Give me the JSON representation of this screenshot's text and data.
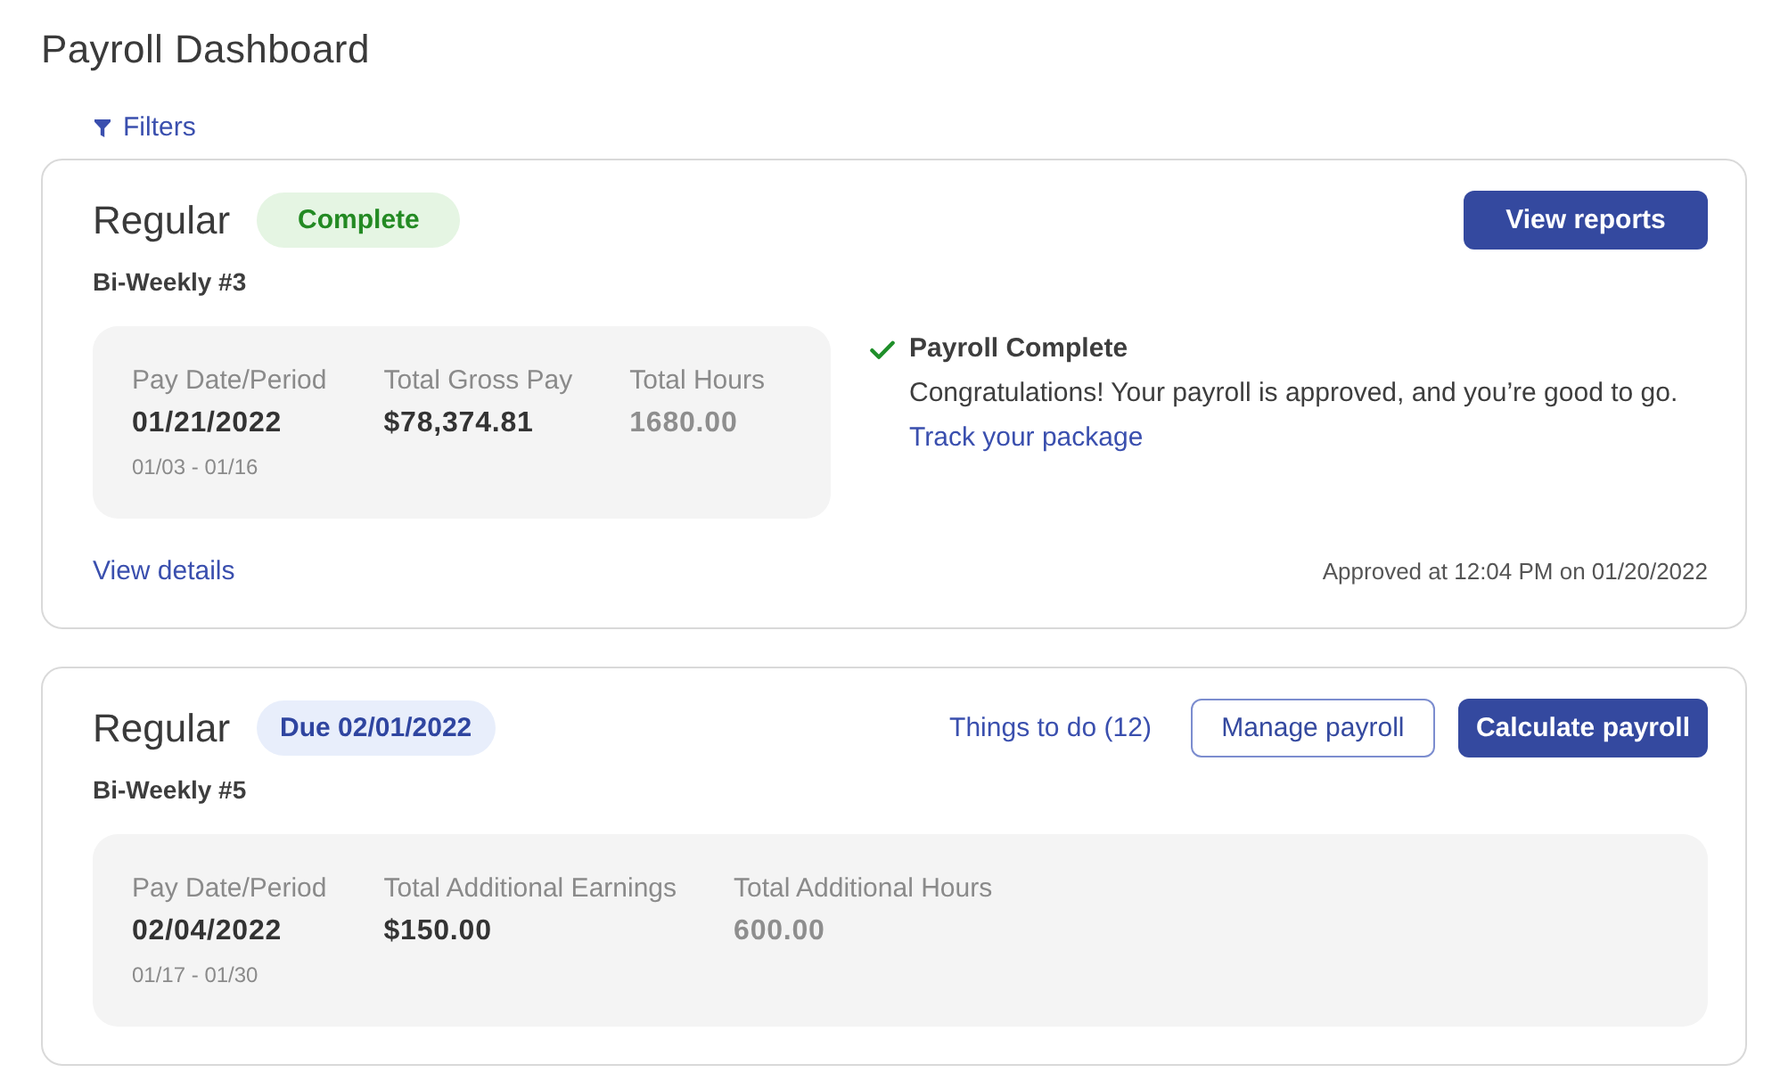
{
  "page_title": "Payroll Dashboard",
  "filters": {
    "label": "Filters"
  },
  "payrolls": [
    {
      "type": "Regular",
      "badge": {
        "label": "Complete",
        "kind": "complete"
      },
      "actions": [
        {
          "label": "View reports",
          "kind": "primary"
        }
      ],
      "schedule": "Bi-Weekly #3",
      "summary": [
        {
          "label": "Pay Date/Period",
          "value": "01/21/2022",
          "sub": "01/03 - 01/16",
          "kind": "date"
        },
        {
          "label": "Total Gross Pay",
          "value": "$78,374.81",
          "kind": "amount"
        },
        {
          "label": "Total Hours",
          "value": "1680.00",
          "kind": "hours"
        }
      ],
      "status": {
        "title": "Payroll Complete",
        "message": "Congratulations! Your payroll is approved, and you’re good to go.",
        "link": "Track your package"
      },
      "footer": {
        "link": "View details",
        "note": "Approved at 12:04 PM on 01/20/2022"
      }
    },
    {
      "type": "Regular",
      "badge": {
        "label": "Due 02/01/2022",
        "kind": "due"
      },
      "actions": [
        {
          "label": "Things to do (12)",
          "kind": "link"
        },
        {
          "label": "Manage payroll",
          "kind": "outline"
        },
        {
          "label": "Calculate payroll",
          "kind": "primary"
        }
      ],
      "schedule": "Bi-Weekly #5",
      "summary": [
        {
          "label": "Pay Date/Period",
          "value": "02/04/2022",
          "sub": "01/17 - 01/30",
          "kind": "date"
        },
        {
          "label": "Total Additional Earnings",
          "value": "$150.00",
          "kind": "amount"
        },
        {
          "label": "Total Additional Hours",
          "value": "600.00",
          "kind": "hours"
        }
      ]
    }
  ]
}
